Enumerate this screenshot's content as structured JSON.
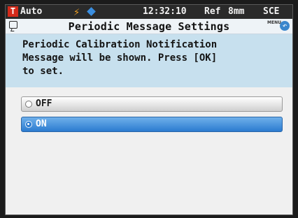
{
  "status_bar": {
    "mode_badge": "T",
    "mode": "Auto",
    "flash_icon": "lightning-icon",
    "measure_icon": "diamond-icon",
    "clock": "12:32:10",
    "ref": "Ref",
    "aperture": "8mm",
    "specular": "SCE"
  },
  "title_bar": {
    "title": "Periodic Message Settings",
    "left_icon": "memo-icon",
    "menu_label": "MENU",
    "menu_icon": "return-arrow-icon"
  },
  "message": "Periodic Calibration Notification\nMessage will be shown. Press [OK]\nto set.",
  "options": [
    {
      "label": "OFF",
      "selected": false
    },
    {
      "label": "ON",
      "selected": true
    }
  ],
  "colors": {
    "status_bar_bg": "#2a2a2a",
    "message_bg": "#c7e0ee",
    "selected_option": "#2b7bd0",
    "mode_badge": "#d42a1a"
  }
}
